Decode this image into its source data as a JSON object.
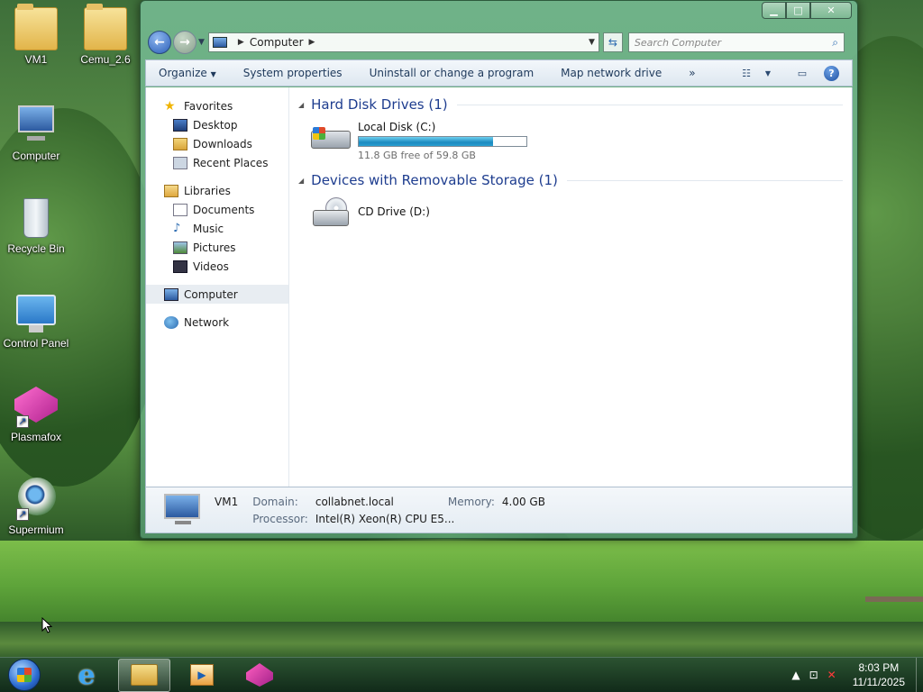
{
  "desktop": {
    "icons": [
      {
        "label": "VM1",
        "icon": "user-folder-icon"
      },
      {
        "label": "Cemu_2.6",
        "icon": "folder-icon"
      },
      {
        "label": "Computer",
        "icon": "computer-icon"
      },
      {
        "label": "Recycle Bin",
        "icon": "recycle-bin-icon"
      },
      {
        "label": "Control Panel",
        "icon": "control-panel-icon"
      },
      {
        "label": "Plasmafox",
        "icon": "plasmafox-icon"
      },
      {
        "label": "Supermium",
        "icon": "supermium-icon"
      }
    ]
  },
  "window": {
    "address": {
      "location": "Computer"
    },
    "search": {
      "placeholder": "Search Computer"
    },
    "toolbar": {
      "organize": "Organize",
      "system_properties": "System properties",
      "uninstall": "Uninstall or change a program",
      "map_network": "Map network drive",
      "more": "»"
    },
    "nav_pane": {
      "favorites": "Favorites",
      "favorites_items": [
        "Desktop",
        "Downloads",
        "Recent Places"
      ],
      "libraries": "Libraries",
      "libraries_items": [
        "Documents",
        "Music",
        "Pictures",
        "Videos"
      ],
      "computer": "Computer",
      "network": "Network"
    },
    "groups": {
      "hard_disks": {
        "title": "Hard Disk Drives (1)",
        "drive": {
          "name": "Local Disk (C:)",
          "free_text": "11.8 GB free of 59.8 GB",
          "used_fraction": 0.803
        }
      },
      "removable": {
        "title": "Devices with Removable Storage (1)",
        "drive": {
          "name": "CD Drive (D:)"
        }
      }
    },
    "details": {
      "name": "VM1",
      "domain_label": "Domain:",
      "domain": "collabnet.local",
      "memory_label": "Memory:",
      "memory": "4.00 GB",
      "processor_label": "Processor:",
      "processor": "Intel(R) Xeon(R) CPU E5..."
    }
  },
  "taskbar": {
    "clock_time": "8:03 PM",
    "clock_date": "11/11/2025"
  }
}
